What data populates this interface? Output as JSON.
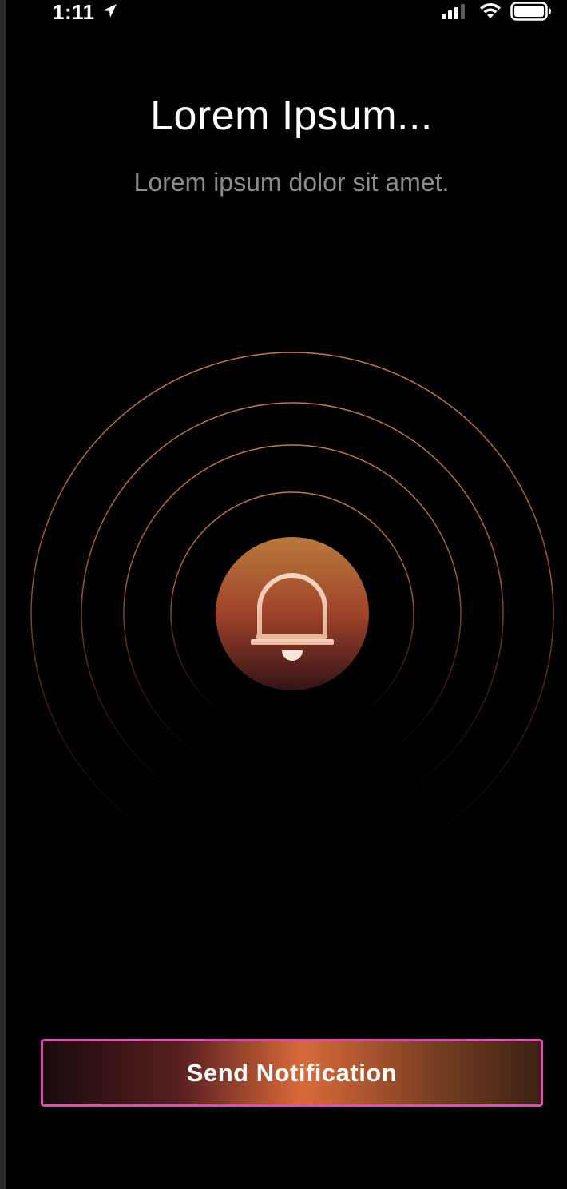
{
  "status_bar": {
    "time": "1:11",
    "icons": [
      "location-arrow-icon",
      "cellular-signal-icon",
      "wifi-icon",
      "battery-icon"
    ]
  },
  "header": {
    "title": "Lorem Ipsum...",
    "subtitle": "Lorem ipsum dolor sit amet."
  },
  "bell": {
    "icon": "bell-icon"
  },
  "actions": {
    "send_label": "Send Notification"
  },
  "colors": {
    "background": "#000000",
    "subtitle_text": "#8c8c8c",
    "ring_stroke": "#c9784a",
    "accent_gradient_top": "#b97a3d",
    "accent_gradient_mid": "#a0432a",
    "accent_gradient_bottom": "#331316",
    "button_border": "#e84bb5",
    "button_highlight": "#d96a3a"
  }
}
